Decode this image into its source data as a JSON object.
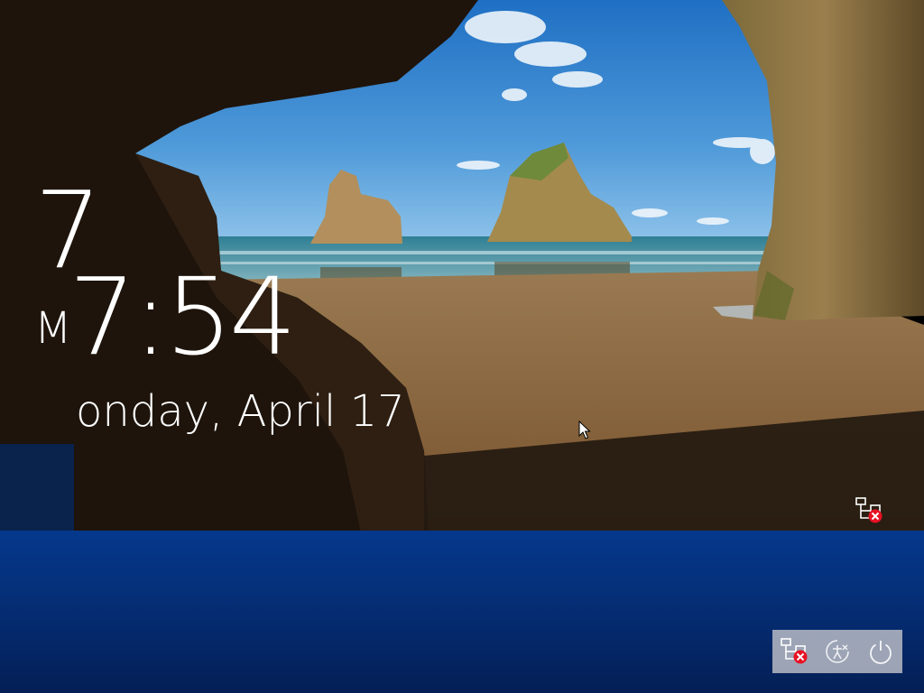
{
  "lockscreen": {
    "hour_fragment": "7",
    "ampm_fragment": "M",
    "time_fragment": "7:54",
    "date_fragment": "onday, April 17"
  },
  "icons": {
    "network_status": "network-disconnected-icon",
    "ease_of_access": "ease-of-access-icon",
    "power": "power-icon",
    "cursor": "mouse-pointer-icon"
  },
  "colors": {
    "panel_blue": "#05388c",
    "tray_bg": "#c8c8cd",
    "error_red": "#e81123"
  }
}
